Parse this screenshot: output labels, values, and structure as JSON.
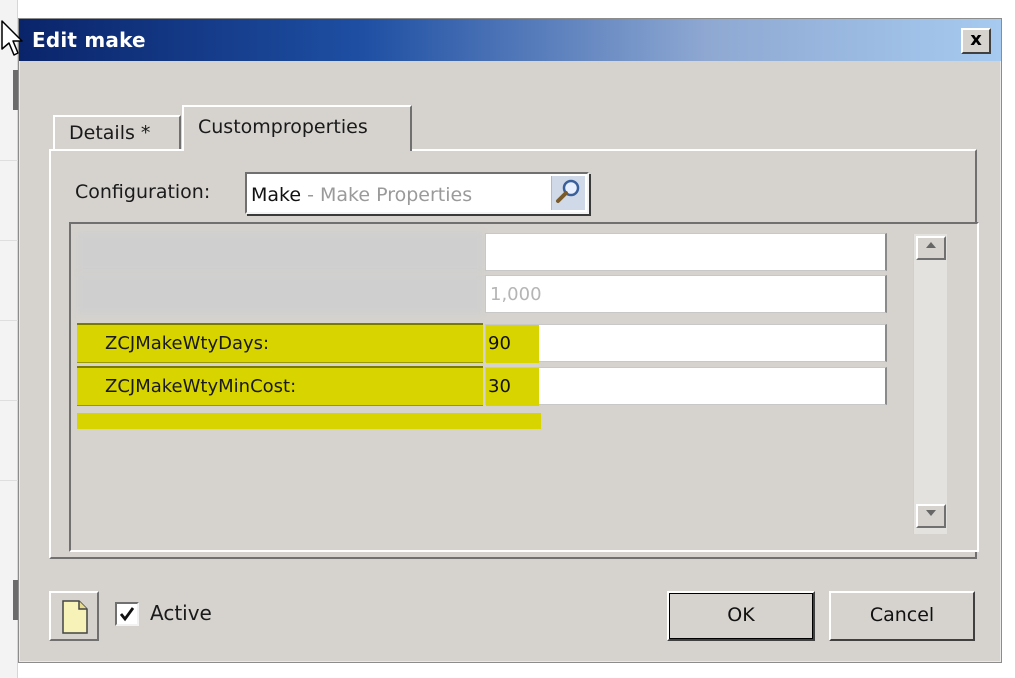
{
  "window": {
    "title": "Edit make",
    "close_label": "x"
  },
  "tabs": [
    {
      "label": "Details *",
      "active": false
    },
    {
      "label": "Customproperties",
      "active": true
    }
  ],
  "configuration": {
    "label": "Configuration:",
    "value_main": "Make",
    "value_sub": " - Make Properties"
  },
  "grid": {
    "rows": [
      {
        "label": "",
        "value": "",
        "obscured": true
      },
      {
        "label": "",
        "value": "1,000",
        "obscured": true
      },
      {
        "label": "ZCJMakeWtyDays:",
        "value": "90",
        "highlighted": true
      },
      {
        "label": "ZCJMakeWtyMinCost:",
        "value": "30",
        "highlighted": true
      }
    ]
  },
  "footer": {
    "active_label": "Active",
    "active_checked": true,
    "ok_label": "OK",
    "cancel_label": "Cancel"
  },
  "colors": {
    "highlight": "#d8d400",
    "titlebar_start": "#0a246a",
    "titlebar_end": "#a6caf0",
    "dialog_bg": "#d6d3ce"
  },
  "icons": [
    "search-icon",
    "document-icon",
    "checkmark-icon",
    "scroll-up-icon",
    "scroll-down-icon",
    "mouse-cursor-icon"
  ]
}
